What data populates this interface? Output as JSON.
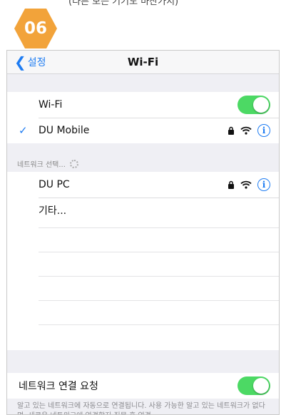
{
  "top_strip": {
    "text": "(다른 모든 기기도 마찬가지)"
  },
  "step_badge": {
    "number": "06",
    "color": "#f2a33a"
  },
  "navbar": {
    "back_label": "설정",
    "title": "Wi-Fi"
  },
  "wifi": {
    "label": "Wi-Fi",
    "enabled": true
  },
  "connected_network": {
    "name": "DU Mobile",
    "secured": true,
    "info_glyph": "i"
  },
  "choose_network": {
    "header": "네트워크 선택..."
  },
  "networks": [
    {
      "name": "DU PC",
      "secured": true,
      "info_glyph": "i"
    },
    {
      "name": "기타..."
    }
  ],
  "ask_to_join": {
    "label": "네트워크 연결 요청",
    "enabled": true,
    "footnote": "알고 있는 네트워크에 자동으로 연결됩니다. 사용 가능한 알고 있는 네트워크가 없다면, 새로운 네트워크에 연결할지 질문 후 연결"
  },
  "colors": {
    "accent": "#1e7cf2",
    "toggle_on": "#4cd964",
    "grouped_bg": "#efeff4"
  },
  "icons": [
    "chevron-left-icon",
    "checkmark-icon",
    "lock-icon",
    "wifi-icon",
    "info-icon",
    "spinner-icon"
  ]
}
